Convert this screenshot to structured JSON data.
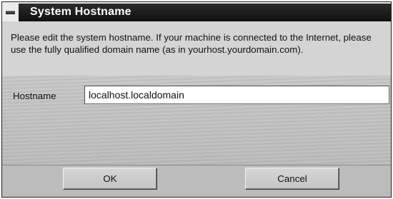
{
  "window": {
    "title": "System Hostname"
  },
  "description": "Please edit the system hostname. If your machine is connected to the Internet, please use the fully qualified domain name (as in yourhost.yourdomain.com).",
  "hostname": {
    "label": "Hostname",
    "value": "localhost.localdomain"
  },
  "buttons": {
    "ok_label": "OK",
    "cancel_label": "Cancel"
  },
  "icons": {
    "window_menu": "window-menu-icon"
  }
}
